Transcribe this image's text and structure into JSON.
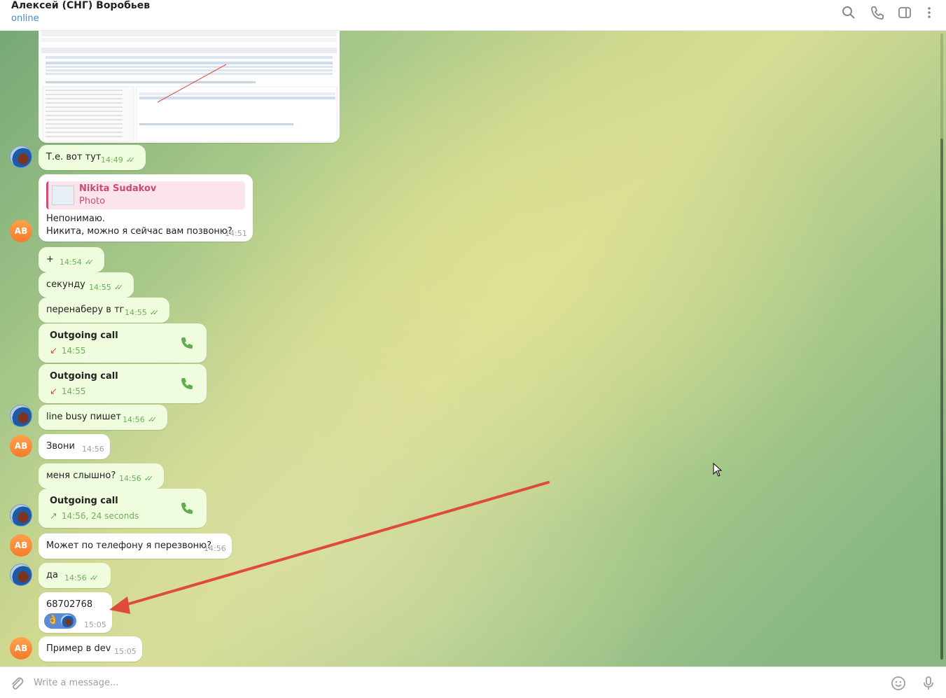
{
  "header": {
    "name": "Алексей (СНГ) Воробьев",
    "status": "online",
    "icons": [
      "search-icon",
      "phone-icon",
      "sidebar-toggle-icon",
      "more-vert-icon"
    ]
  },
  "messages": {
    "m1": {
      "text": "Т.е. вот тут",
      "time": "14:49"
    },
    "m2": {
      "reply_name": "Nikita Sudakov",
      "reply_sub": "Photo",
      "line1": "Непонимаю.",
      "line2": "Никита, можно я сейчас вам позвоню?",
      "time": "14:51"
    },
    "m3": {
      "text": "+",
      "time": "14:54"
    },
    "m4": {
      "text": "секунду",
      "time": "14:55"
    },
    "m5": {
      "text": "перенаберу в тг",
      "time": "14:55"
    },
    "c1": {
      "title": "Outgoing call",
      "sub": "14:55"
    },
    "c2": {
      "title": "Outgoing call",
      "sub": "14:55"
    },
    "m6": {
      "text": "line busy пишет",
      "time": "14:56"
    },
    "m7": {
      "text": "Звони",
      "time": "14:56"
    },
    "m8": {
      "text": "меня слышно?",
      "time": "14:56"
    },
    "c3": {
      "title": "Outgoing call",
      "sub": "14:56, 24 seconds"
    },
    "m9": {
      "text": "Может по телефону я перезвоню?",
      "time": "14:56"
    },
    "m10": {
      "text": "да",
      "time": "14:56"
    },
    "m11": {
      "text": "68702768",
      "time": "15:05"
    },
    "m12": {
      "text": "Пример в dev",
      "time": "15:05"
    }
  },
  "avatar_initials": "AB",
  "composer": {
    "placeholder": "Write a message..."
  },
  "colors": {
    "outgoing_bubble": "#effdde",
    "incoming_bubble": "#ffffff",
    "accent": "#3a8ccf",
    "arrow": "#e04a3c"
  }
}
